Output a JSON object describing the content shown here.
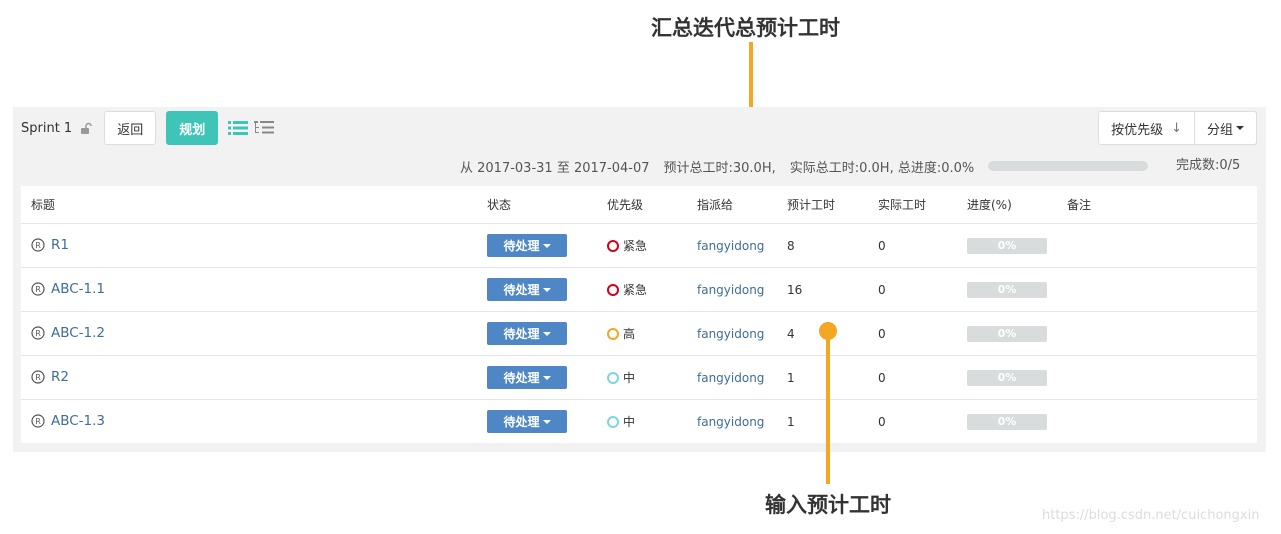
{
  "annotations": {
    "top": "汇总迭代总预计工时",
    "bottom": "输入预计工时",
    "color": "#f5a623"
  },
  "toolbar": {
    "sprint_name": "Sprint 1",
    "lock_icon": "lock-open-icon",
    "back_label": "返回",
    "plan_label": "规划",
    "sort_label": "按优先级",
    "sort_arrow": "↓",
    "group_label": "分组"
  },
  "summary": {
    "range": "从 2017-03-31 至 2017-04-07",
    "estimated": "预计总工时:30.0H,",
    "actual_progress": "实际总工时:0.0H, 总进度:0.0%",
    "progress": 0,
    "done": "完成数:0/5"
  },
  "table": {
    "headers": {
      "title": "标题",
      "status": "状态",
      "priority": "优先级",
      "assignee": "指派给",
      "estimated": "预计工时",
      "actual": "实际工时",
      "progress": "进度(%)",
      "note": "备注"
    },
    "rows": [
      {
        "title": "R1",
        "status": "待处理",
        "priority": "紧急",
        "priority_color": "#d0021b",
        "assignee": "fangyidong",
        "estimated": "8",
        "actual": "0",
        "progress": "0%"
      },
      {
        "title": "ABC-1.1",
        "status": "待处理",
        "priority": "紧急",
        "priority_color": "#d0021b",
        "assignee": "fangyidong",
        "estimated": "16",
        "actual": "0",
        "progress": "0%"
      },
      {
        "title": "ABC-1.2",
        "status": "待处理",
        "priority": "高",
        "priority_color": "#f5a623",
        "assignee": "fangyidong",
        "estimated": "4",
        "actual": "0",
        "progress": "0%"
      },
      {
        "title": "R2",
        "status": "待处理",
        "priority": "中",
        "priority_color": "#7fd3e6",
        "assignee": "fangyidong",
        "estimated": "1",
        "actual": "0",
        "progress": "0%"
      },
      {
        "title": "ABC-1.3",
        "status": "待处理",
        "priority": "中",
        "priority_color": "#7fd3e6",
        "assignee": "fangyidong",
        "estimated": "1",
        "actual": "0",
        "progress": "0%"
      }
    ]
  },
  "watermark": "https://blog.csdn.net/cuichongxin"
}
